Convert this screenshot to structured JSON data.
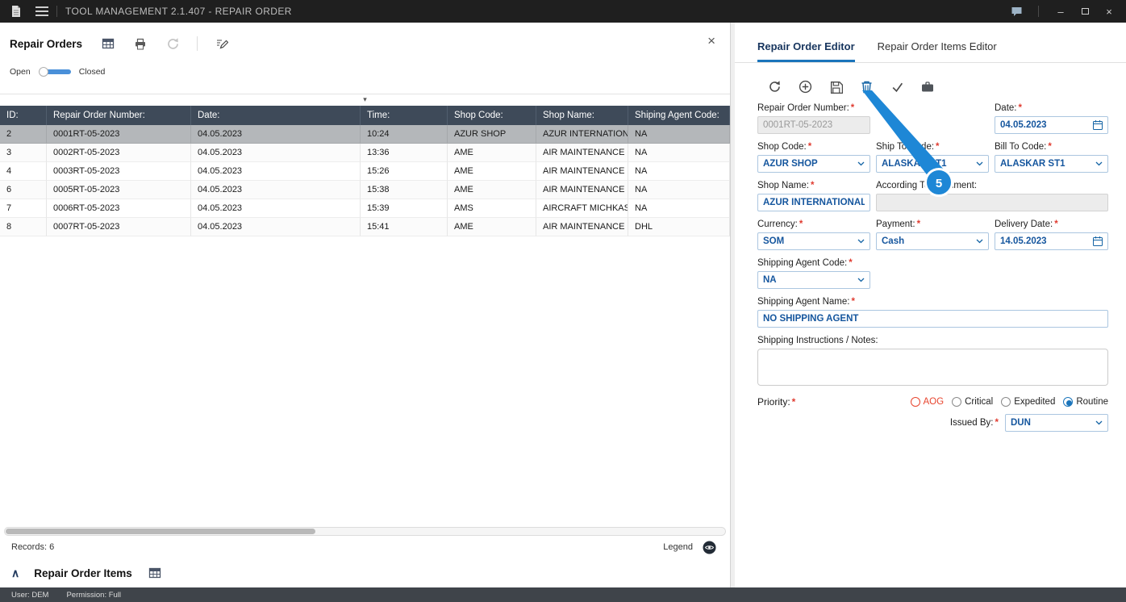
{
  "icons": {
    "close": "×",
    "minimize": "–",
    "chevron_up": "∧",
    "sort": "▾"
  },
  "titlebar": {
    "title": "TOOL MANAGEMENT 2.1.407 - REPAIR ORDER"
  },
  "left": {
    "title": "Repair Orders",
    "toggle_open": "Open",
    "toggle_closed": "Closed",
    "grid": {
      "columns": [
        "ID:",
        "Repair Order Number:",
        "Date:",
        "Time:",
        "Shop Code:",
        "Shop Name:",
        "Shiping Agent Code:"
      ],
      "rows": [
        [
          "2",
          "0001RT-05-2023",
          "04.05.2023",
          "10:24",
          "AZUR SHOP",
          "AZUR INTERNATION...",
          "NA"
        ],
        [
          "3",
          "0002RT-05-2023",
          "04.05.2023",
          "13:36",
          "AME",
          "AIR MAINTENANCE E...",
          "NA"
        ],
        [
          "4",
          "0003RT-05-2023",
          "04.05.2023",
          "15:26",
          "AME",
          "AIR MAINTENANCE E...",
          "NA"
        ],
        [
          "6",
          "0005RT-05-2023",
          "04.05.2023",
          "15:38",
          "AME",
          "AIR MAINTENANCE E...",
          "NA"
        ],
        [
          "7",
          "0006RT-05-2023",
          "04.05.2023",
          "15:39",
          "AMS",
          "AIRCRAFT MICHKAS...",
          "NA"
        ],
        [
          "8",
          "0007RT-05-2023",
          "04.05.2023",
          "15:41",
          "AME",
          "AIR MAINTENANCE E...",
          "DHL"
        ]
      ]
    },
    "records": "Records: 6",
    "legend": "Legend",
    "items_title": "Repair Order Items"
  },
  "editor": {
    "tab_editor": "Repair Order Editor",
    "tab_items": "Repair Order Items Editor",
    "required_mark": "*",
    "annotation_number": "5",
    "fields": {
      "repair_order_number": {
        "label": "Repair Order Number:",
        "value": "0001RT-05-2023"
      },
      "date": {
        "label": "Date:",
        "value": "04.05.2023"
      },
      "shop_code": {
        "label": "Shop Code:",
        "value": "AZUR SHOP"
      },
      "ship_to_code": {
        "label": "Ship To Code:",
        "value": "ALASKAR ST1"
      },
      "bill_to_code": {
        "label": "Bill To Code:",
        "value": "ALASKAR ST1"
      },
      "shop_name": {
        "label": "Shop Name:",
        "value": "AZUR INTERNATIONAL COM"
      },
      "according_to_document": {
        "label": "According To Document:",
        "value": ""
      },
      "currency": {
        "label": "Currency:",
        "value": "SOM"
      },
      "payment": {
        "label": "Payment:",
        "value": "Cash"
      },
      "delivery_date": {
        "label": "Delivery Date:",
        "value": "14.05.2023"
      },
      "shipping_agent_code": {
        "label": "Shipping Agent Code:",
        "value": "NA"
      },
      "shipping_agent_name": {
        "label": "Shipping Agent Name:",
        "value": "NO SHIPPING AGENT"
      },
      "shipping_notes": {
        "label": "Shipping Instructions / Notes:",
        "value": ""
      },
      "priority": {
        "label": "Priority:",
        "aog": "AOG",
        "critical": "Critical",
        "expedited": "Expedited",
        "routine": "Routine",
        "selected": "Routine"
      },
      "issued_by": {
        "label": "Issued By:",
        "value": "DUN"
      }
    }
  },
  "statusbar": {
    "user": "User: DEM",
    "permission": "Permission: Full"
  }
}
